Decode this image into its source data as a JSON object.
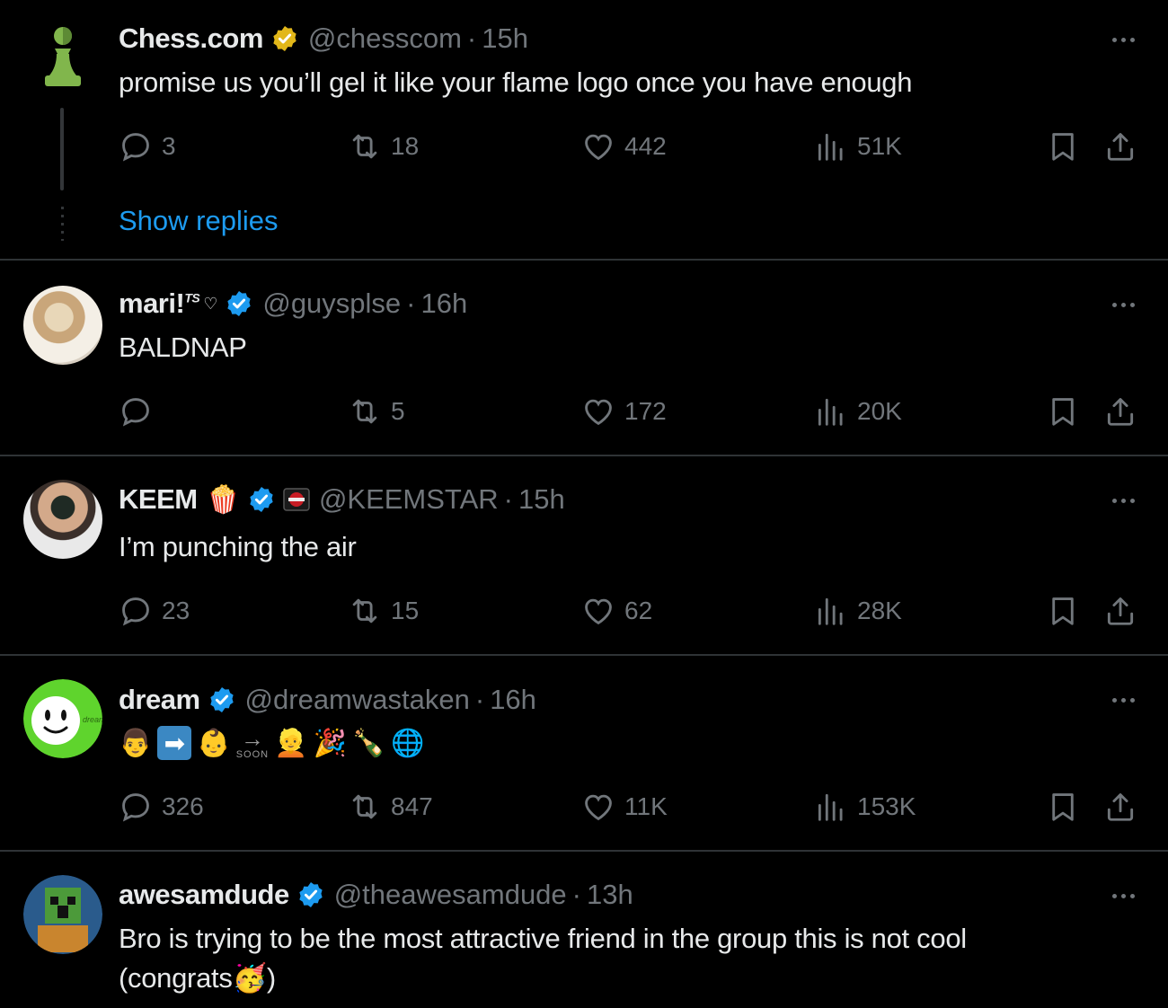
{
  "colors": {
    "background": "#000000",
    "text": "#e7e9ea",
    "muted": "#71767b",
    "accent": "#1d9bf0",
    "gold_badge": "#e2b719",
    "blue_badge": "#1d9bf0",
    "divider": "#2f3336"
  },
  "tweets": [
    {
      "name": "Chess.com",
      "handle": "@chesscom",
      "time": "15h",
      "badge": "gold-verified-icon",
      "text": "promise us you’ll gel it like your flame logo once you have enough",
      "replies": "3",
      "retweets": "18",
      "likes": "442",
      "views": "51K",
      "show_replies": "Show replies"
    },
    {
      "name": "mari!",
      "name_sup": "TS",
      "name_suffix": "♡",
      "handle": "@guysplse",
      "time": "16h",
      "badge": "blue-verified-icon",
      "text": "BALDNAP",
      "replies": "",
      "retweets": "5",
      "likes": "172",
      "views": "20K"
    },
    {
      "name": "KEEM",
      "name_emoji": "🍿",
      "handle": "@KEEMSTAR",
      "time": "15h",
      "badge": "blue-verified-icon",
      "text": "I’m punching the air",
      "replies": "23",
      "retweets": "15",
      "likes": "62",
      "views": "28K"
    },
    {
      "name": "dream",
      "handle": "@dreamwastaken",
      "time": "16h",
      "badge": "blue-verified-icon",
      "emoji_sequence": [
        "👨",
        "➡",
        "👶",
        "→",
        "SOON",
        "👱",
        "🎉",
        "🍾",
        "🌐"
      ],
      "replies": "326",
      "retweets": "847",
      "likes": "11K",
      "views": "153K"
    },
    {
      "name": "awesamdude",
      "handle": "@theawesamdude",
      "time": "13h",
      "badge": "blue-verified-icon",
      "text_line1": "Bro is trying to be the most attractive friend in the group this is not cool",
      "text_line2": "(congrats🥳)"
    }
  ],
  "separator": "·"
}
